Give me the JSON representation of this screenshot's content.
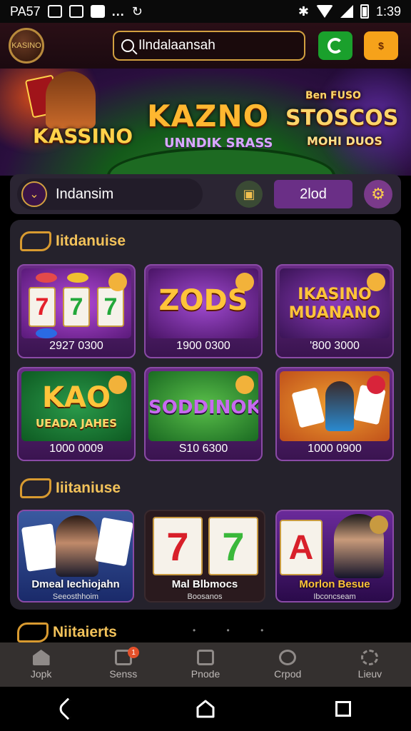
{
  "status_bar": {
    "carrier": "PA57",
    "time": "1:39",
    "more": "..."
  },
  "header": {
    "logo_text": "KASINO",
    "search_value": "Ilndalaansah",
    "orange_button_label": "$"
  },
  "banner": {
    "left_title": "KASSINO",
    "center_title": "KAZNO",
    "center_subtitle": "UNNDIK SRASS",
    "right_top": "Ben FUSO",
    "right_title": "STOSCOS",
    "right_subtitle": "MOHI DUOS"
  },
  "user_bar": {
    "name": "Indansim",
    "balance": "2lod"
  },
  "sections": [
    {
      "title": "Iitdanuise",
      "games": [
        {
          "name": "777",
          "amount": "2927 0300",
          "badge": ""
        },
        {
          "name": "ZODS",
          "amount": "1900 0300",
          "badge": ""
        },
        {
          "name": "IKASINO MUANANO",
          "amount": "'800 3000",
          "badge": ""
        },
        {
          "name": "KAO",
          "sub": "UEADA JAHES",
          "amount": "1000 0009",
          "badge": ""
        },
        {
          "name": "SODDINOK",
          "amount": "S10 6300",
          "badge": ""
        },
        {
          "name": "",
          "amount": "1000 0900",
          "badge": ""
        }
      ]
    },
    {
      "title": "Iiitaniuse",
      "featured": [
        {
          "name": "Dmeal Iechiojahn",
          "sub": "Seeosthhoim"
        },
        {
          "name": "Mal Blbmocs",
          "sub": "Boosanos"
        },
        {
          "name": "Morlon Besue",
          "sub": "Ibconcseam"
        }
      ]
    },
    {
      "title": "Niitaierts"
    }
  ],
  "bottom_nav": [
    {
      "label": "Jopk",
      "icon": "home-icon"
    },
    {
      "label": "Senss",
      "icon": "mail-icon",
      "badge": "1"
    },
    {
      "label": "Pnode",
      "icon": "book-icon"
    },
    {
      "label": "Crpod",
      "icon": "search-circle-icon"
    },
    {
      "label": "Lieuv",
      "icon": "settings-icon"
    }
  ],
  "colors": {
    "accent_gold": "#f2c25a",
    "purple": "#6a2f86",
    "panel": "#25222c"
  }
}
